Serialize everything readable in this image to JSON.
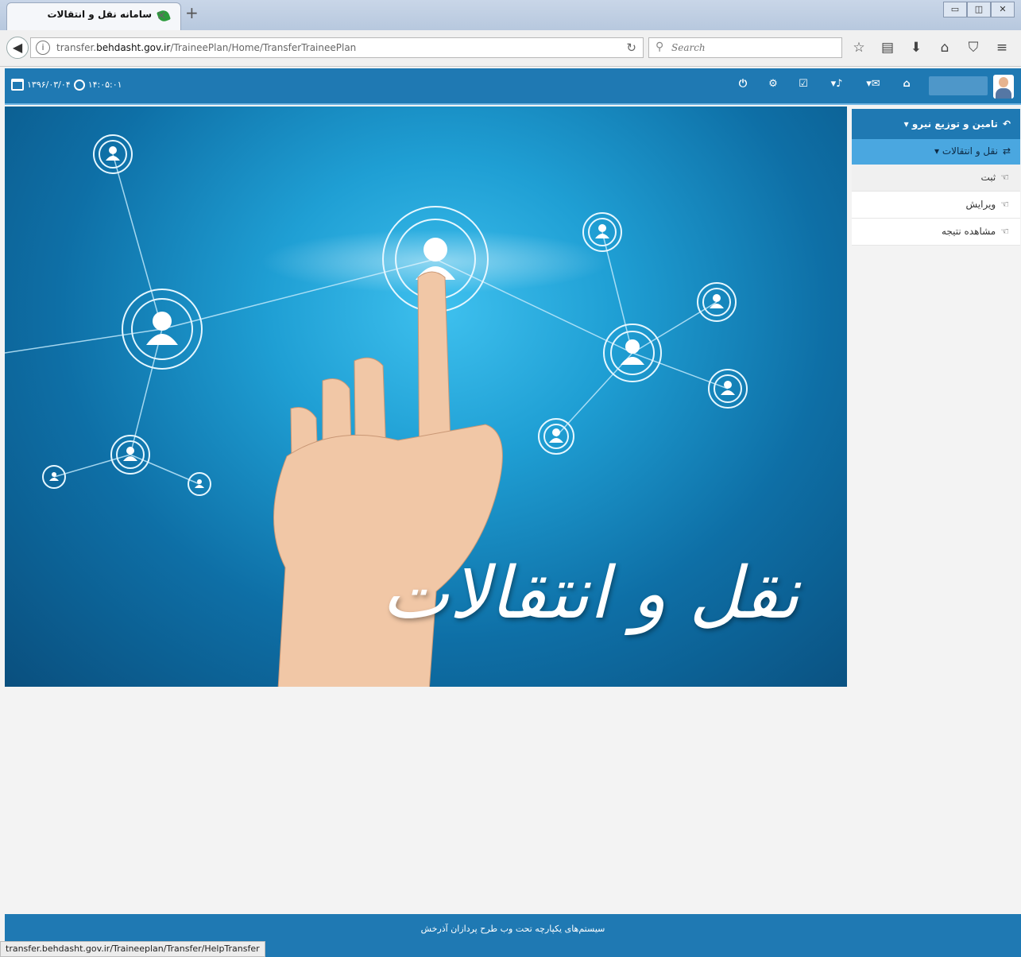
{
  "browser": {
    "tab_title": "سامانه نقل و انتقالات",
    "tab_close": "×",
    "new_tab": "+",
    "url_prefix": "transfer.",
    "url_domain": "behdasht.gov.ir",
    "url_path": "/TraineePlan/Home/TransferTraineePlan",
    "search_placeholder": "Search",
    "status_url": "transfer.behdasht.gov.ir/Traineeplan/Transfer/HelpTransfer"
  },
  "header": {
    "date": "۱۳۹۶/۰۳/۰۴",
    "time": "۱۴:۰۵:۰۱"
  },
  "sidebar": {
    "section_label": "تامین و توزیع نیرو",
    "group_label": "نقل و انتقالات",
    "items": [
      {
        "label": "ثبت"
      },
      {
        "label": "ویرایش"
      },
      {
        "label": "مشاهده نتیجه"
      }
    ]
  },
  "hero": {
    "caption": "نقل و انتقالات"
  },
  "footer": {
    "text": "سیستم‌های یکپارچه تحت وب طرح پردازان آذرخش"
  },
  "colors": {
    "primary": "#1f79b3",
    "highlight": "#4aa7e0"
  }
}
